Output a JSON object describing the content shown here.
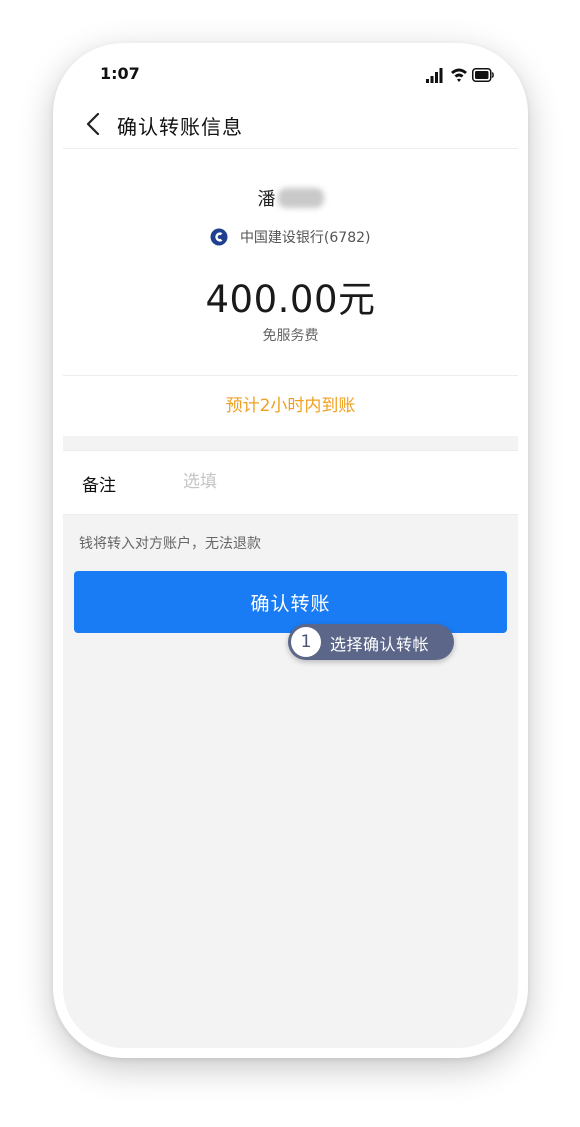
{
  "status_bar": {
    "time": "1:07",
    "icons": [
      "signal-icon",
      "wifi-icon",
      "battery-icon"
    ]
  },
  "nav": {
    "back_icon": "chevron-left-icon",
    "title": "确认转账信息"
  },
  "payee": {
    "name_visible": "潘",
    "bank_icon": "ccb-bank-logo-icon",
    "bank": "中国建设银行(6782)",
    "amount": "400.00元",
    "fee_note": "免服务费"
  },
  "eta": {
    "text": "预计2小时内到账"
  },
  "remark": {
    "label": "备注",
    "placeholder": "选填",
    "value": ""
  },
  "warning": "钱将转入对方账户，无法退款",
  "confirm_button": {
    "label": "确认转账"
  },
  "tooltip": {
    "step": "1",
    "text": "选择确认转帐"
  },
  "colors": {
    "primary": "#1a7cf5",
    "eta_text": "#f0a020",
    "tooltip_bg": "#5b6689",
    "bank_logo": "#1f3f8f",
    "page_bg": "#f3f3f3"
  }
}
